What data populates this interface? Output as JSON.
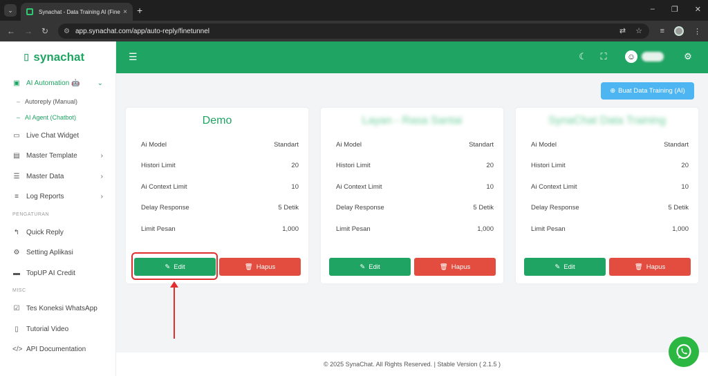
{
  "browser": {
    "tab_title": "Synachat - Data Training AI (Fine T",
    "url": "app.synachat.com/app/auto-reply/finetunnel",
    "new_tab": "+",
    "tab_close": "×"
  },
  "brand": {
    "name": "synachat"
  },
  "sidebar": {
    "ai_automation": {
      "label": "AI Automation 🤖",
      "icon": "robot-icon"
    },
    "ai_sub": [
      {
        "label": "Autoreply (Manual)"
      },
      {
        "label": "AI Agent (Chatbot)"
      }
    ],
    "items_main": [
      {
        "label": "Live Chat Widget",
        "icon": "chat-window-icon"
      },
      {
        "label": "Master Template",
        "icon": "template-icon"
      },
      {
        "label": "Master Data",
        "icon": "list-icon"
      },
      {
        "label": "Log Reports",
        "icon": "report-icon"
      }
    ],
    "section_pengaturan": "PENGATURAN",
    "items_pengaturan": [
      {
        "label": "Quick Reply",
        "icon": "reply-icon"
      },
      {
        "label": "Setting Aplikasi",
        "icon": "gear-icon"
      },
      {
        "label": "TopUP AI Credit",
        "icon": "wallet-icon"
      }
    ],
    "section_misc": "MISC",
    "items_misc": [
      {
        "label": "Tes Koneksi WhatsApp",
        "icon": "message-check-icon"
      },
      {
        "label": "Tutorial Video",
        "icon": "book-icon"
      },
      {
        "label": "API Documentation",
        "icon": "code-icon"
      }
    ]
  },
  "header": {
    "icons": [
      "menu-icon",
      "moon-icon",
      "fullscreen-icon",
      "user-avatar-icon",
      "gear-icon"
    ]
  },
  "main": {
    "create_button": "Buat Data Training (AI)",
    "spec_labels": [
      "Ai Model",
      "Histori Limit",
      "Ai Context Limit",
      "Delay Response",
      "Limit Pesan"
    ],
    "cards": [
      {
        "title": "Demo",
        "values": [
          "Standart",
          "20",
          "10",
          "5 Detik",
          "1,000"
        ]
      },
      {
        "title": "Layan - Rasa Santai",
        "values": [
          "Standart",
          "20",
          "10",
          "5 Detik",
          "1,000"
        ]
      },
      {
        "title": "SynaChat Data Training",
        "values": [
          "Standart",
          "20",
          "10",
          "5 Detik",
          "1,000"
        ]
      }
    ],
    "edit_label": "Edit",
    "delete_label": "Hapus"
  },
  "footer": {
    "text": "© 2025 SynaChat. All Rights Reserved. | Stable Version ( 2.1.5 )"
  },
  "colors": {
    "brand_green": "#1fa463",
    "danger_red": "#e34d3f",
    "info_blue": "#4db5f2",
    "annotation_red": "#e12d2d",
    "whatsapp_green": "#2bb741"
  }
}
